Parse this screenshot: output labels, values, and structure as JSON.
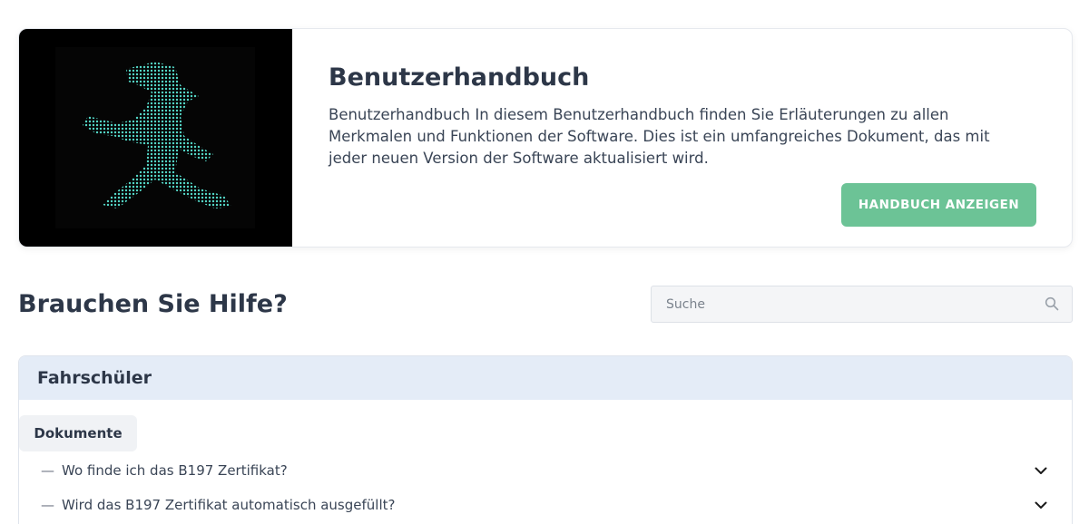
{
  "hero": {
    "title": "Benutzerhandbuch",
    "description": "Benutzerhandbuch In diesem Benutzerhandbuch finden Sie Erläuterungen zu allen Merkmalen und Funktionen der Software. Dies ist ein umfangreiches Dokument, das mit jeder neuen Version der Software aktualisiert wird.",
    "button_label": "HANDBUCH ANZEIGEN",
    "image_icon": "ampelmann-green-walking-figure"
  },
  "help": {
    "title": "Brauchen Sie Hilfe?",
    "search_placeholder": "Suche",
    "search_icon": "search-icon"
  },
  "section": {
    "title": "Fahrschüler",
    "tab_label": "Dokumente",
    "items": [
      {
        "dash": "—",
        "question": "Wo finde ich das B197 Zertifikat?"
      },
      {
        "dash": "—",
        "question": "Wird das B197 Zertifikat automatisch ausgefüllt?"
      }
    ]
  },
  "colors": {
    "accent": "#6cc396",
    "panel_header": "#e4ecf7",
    "text": "#2d3748"
  }
}
